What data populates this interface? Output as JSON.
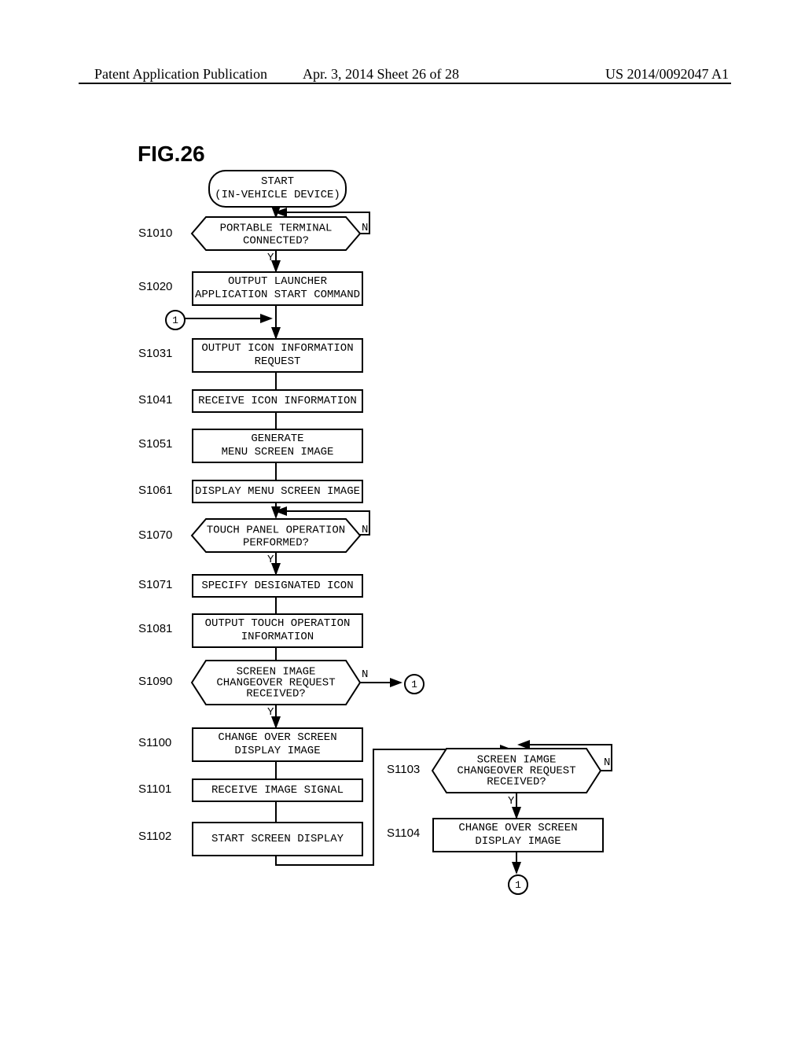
{
  "header": {
    "left": "Patent Application Publication",
    "mid": "Apr. 3, 2014  Sheet 26 of 28",
    "right": "US 2014/0092047 A1"
  },
  "figure": "FIG.26",
  "start": {
    "line1": "START",
    "line2": "(IN-VEHICLE DEVICE)"
  },
  "s1010": {
    "label": "S1010",
    "text": "PORTABLE TERMINAL\nCONNECTED?"
  },
  "s1020": {
    "label": "S1020",
    "text": "OUTPUT LAUNCHER\nAPPLICATION START COMMAND"
  },
  "s1031": {
    "label": "S1031",
    "text": "OUTPUT ICON INFORMATION\nREQUEST"
  },
  "s1041": {
    "label": "S1041",
    "text": "RECEIVE ICON INFORMATION"
  },
  "s1051": {
    "label": "S1051",
    "text": "GENERATE\nMENU SCREEN IMAGE"
  },
  "s1061": {
    "label": "S1061",
    "text": "DISPLAY MENU SCREEN IMAGE"
  },
  "s1070": {
    "label": "S1070",
    "text": "TOUCH PANEL OPERATION\nPERFORMED?"
  },
  "s1071": {
    "label": "S1071",
    "text": "SPECIFY DESIGNATED ICON"
  },
  "s1081": {
    "label": "S1081",
    "text": "OUTPUT TOUCH OPERATION\nINFORMATION"
  },
  "s1090": {
    "label": "S1090",
    "text": "SCREEN IMAGE\nCHANGEOVER REQUEST\nRECEIVED?"
  },
  "s1100": {
    "label": "S1100",
    "text": "CHANGE OVER SCREEN\nDISPLAY IMAGE"
  },
  "s1101": {
    "label": "S1101",
    "text": "RECEIVE IMAGE SIGNAL"
  },
  "s1102": {
    "label": "S1102",
    "text": "START SCREEN DISPLAY"
  },
  "s1103": {
    "label": "S1103",
    "text": "SCREEN IAMGE\nCHANGEOVER REQUEST\nRECEIVED?"
  },
  "s1104": {
    "label": "S1104",
    "text": "CHANGE OVER SCREEN\nDISPLAY IMAGE"
  },
  "yn": {
    "y": "Y",
    "n": "N"
  },
  "connector": "1",
  "chart_data": {
    "type": "flowchart",
    "title": "FIG.26",
    "nodes": [
      {
        "id": "start",
        "kind": "terminator",
        "text": "START (IN-VEHICLE DEVICE)"
      },
      {
        "id": "S1010",
        "kind": "decision",
        "text": "PORTABLE TERMINAL CONNECTED?"
      },
      {
        "id": "S1020",
        "kind": "process",
        "text": "OUTPUT LAUNCHER APPLICATION START COMMAND"
      },
      {
        "id": "C1_left",
        "kind": "onpage",
        "text": "1"
      },
      {
        "id": "S1031",
        "kind": "process",
        "text": "OUTPUT ICON INFORMATION REQUEST"
      },
      {
        "id": "S1041",
        "kind": "process",
        "text": "RECEIVE ICON INFORMATION"
      },
      {
        "id": "S1051",
        "kind": "process",
        "text": "GENERATE MENU SCREEN IMAGE"
      },
      {
        "id": "S1061",
        "kind": "process",
        "text": "DISPLAY MENU SCREEN IMAGE"
      },
      {
        "id": "S1070",
        "kind": "decision",
        "text": "TOUCH PANEL OPERATION PERFORMED?"
      },
      {
        "id": "S1071",
        "kind": "process",
        "text": "SPECIFY DESIGNATED ICON"
      },
      {
        "id": "S1081",
        "kind": "process",
        "text": "OUTPUT TOUCH OPERATION INFORMATION"
      },
      {
        "id": "S1090",
        "kind": "decision",
        "text": "SCREEN IMAGE CHANGEOVER REQUEST RECEIVED?"
      },
      {
        "id": "C1_mid",
        "kind": "onpage",
        "text": "1"
      },
      {
        "id": "S1100",
        "kind": "process",
        "text": "CHANGE OVER SCREEN DISPLAY IMAGE"
      },
      {
        "id": "S1101",
        "kind": "process",
        "text": "RECEIVE IMAGE SIGNAL"
      },
      {
        "id": "S1102",
        "kind": "process",
        "text": "START SCREEN DISPLAY"
      },
      {
        "id": "S1103",
        "kind": "decision",
        "text": "SCREEN IAMGE CHANGEOVER REQUEST RECEIVED?"
      },
      {
        "id": "S1104",
        "kind": "process",
        "text": "CHANGE OVER SCREEN DISPLAY IMAGE"
      },
      {
        "id": "C1_bottom",
        "kind": "onpage",
        "text": "1"
      }
    ],
    "edges": [
      {
        "from": "start",
        "to": "S1010"
      },
      {
        "from": "S1010",
        "to": "S1010",
        "label": "N",
        "loop": true
      },
      {
        "from": "S1010",
        "to": "S1020",
        "label": "Y"
      },
      {
        "from": "S1020",
        "to": "S1031"
      },
      {
        "from": "C1_left",
        "to": "S1031"
      },
      {
        "from": "S1031",
        "to": "S1041"
      },
      {
        "from": "S1041",
        "to": "S1051"
      },
      {
        "from": "S1051",
        "to": "S1061"
      },
      {
        "from": "S1061",
        "to": "S1070"
      },
      {
        "from": "S1070",
        "to": "S1070",
        "label": "N",
        "loop": true
      },
      {
        "from": "S1070",
        "to": "S1071",
        "label": "Y"
      },
      {
        "from": "S1071",
        "to": "S1081"
      },
      {
        "from": "S1081",
        "to": "S1090"
      },
      {
        "from": "S1090",
        "to": "C1_mid",
        "label": "N"
      },
      {
        "from": "S1090",
        "to": "S1100",
        "label": "Y"
      },
      {
        "from": "S1100",
        "to": "S1101"
      },
      {
        "from": "S1101",
        "to": "S1102"
      },
      {
        "from": "S1102",
        "to": "S1103"
      },
      {
        "from": "S1103",
        "to": "S1103",
        "label": "N",
        "loop": true
      },
      {
        "from": "S1103",
        "to": "S1104",
        "label": "Y"
      },
      {
        "from": "S1104",
        "to": "C1_bottom"
      }
    ]
  }
}
